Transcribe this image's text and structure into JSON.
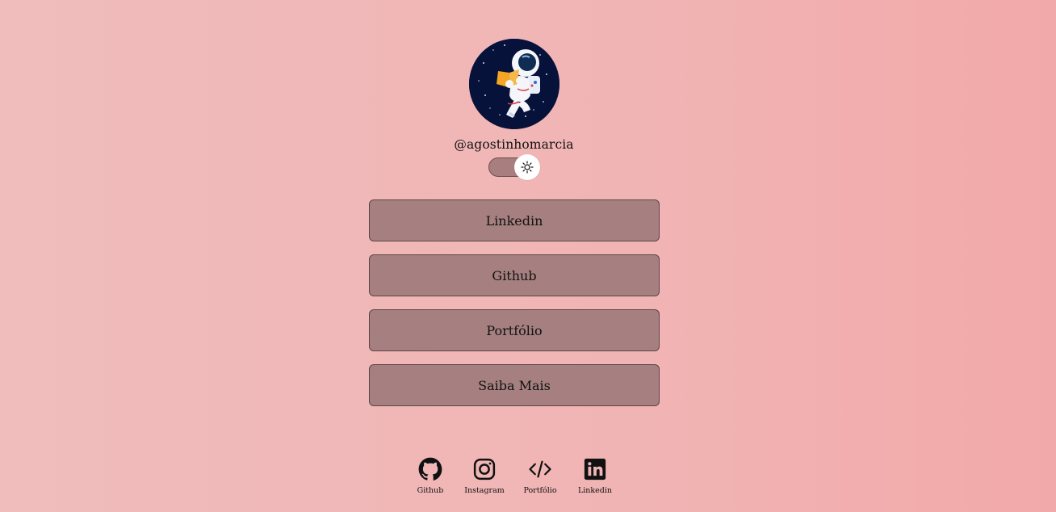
{
  "profile": {
    "username": "@agostinhomarcia",
    "avatar_alt": "astronaut-avatar"
  },
  "theme_toggle": {
    "icon": "sun-icon"
  },
  "links": [
    {
      "label": "Linkedin"
    },
    {
      "label": "Github"
    },
    {
      "label": "Portfólio"
    },
    {
      "label": "Saiba Mais"
    }
  ],
  "footer": {
    "items": [
      {
        "label": "Github",
        "icon": "github-icon"
      },
      {
        "label": "Instagram",
        "icon": "instagram-icon"
      },
      {
        "label": "Portfólio",
        "icon": "code-icon"
      },
      {
        "label": "Linkedin",
        "icon": "linkedin-icon"
      }
    ]
  },
  "colors": {
    "background_start": "#f0bcbc",
    "background_end": "#f2a9a9",
    "button_fill": "#a68080",
    "button_border": "#5e4444",
    "avatar_bg": "#07123a"
  }
}
